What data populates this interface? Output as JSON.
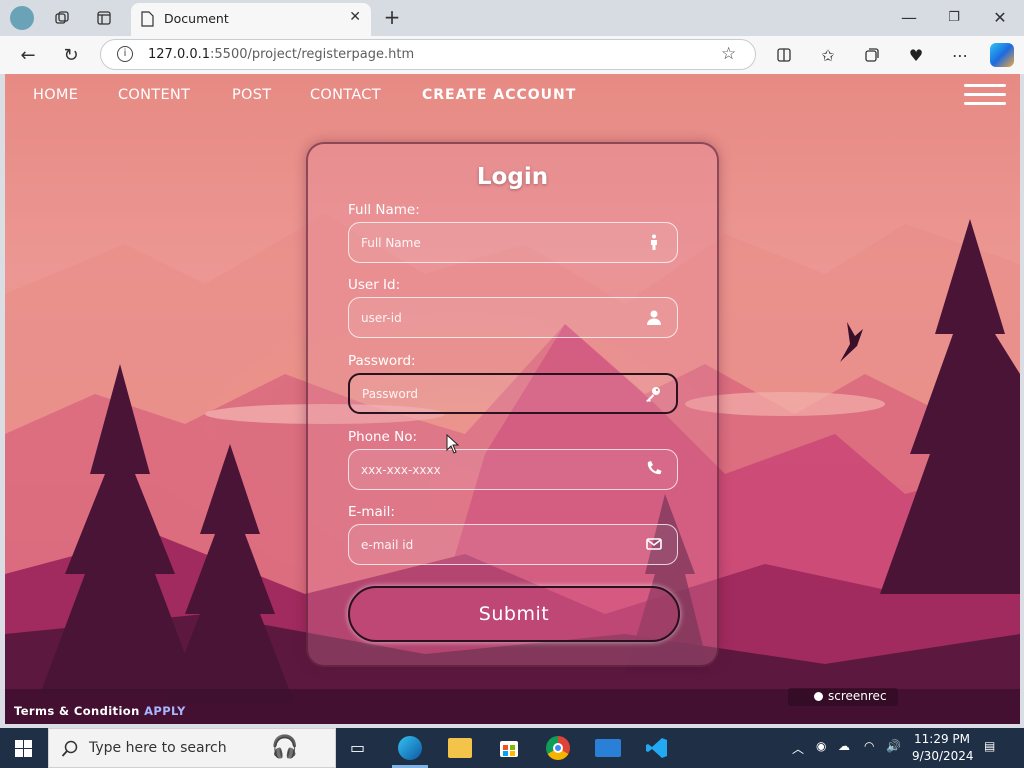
{
  "browser": {
    "tab_title": "Document",
    "url_host": "127.0.0.1",
    "url_rest": ":5500/project/registerpage.htm"
  },
  "nav": {
    "items": [
      "HOME",
      "CONTENT",
      "POST",
      "CONTACT"
    ],
    "create_account": "CREATE ACCOUNT"
  },
  "form": {
    "title": "Login",
    "fields": [
      {
        "label": "Full Name:",
        "placeholder": "Full Name",
        "icon": "person-standing-icon"
      },
      {
        "label": "User Id:",
        "placeholder": "user-id",
        "icon": "user-icon"
      },
      {
        "label": "Password:",
        "placeholder": "Password",
        "icon": "key-icon"
      },
      {
        "label": "Phone No:",
        "placeholder": "xxx-xxx-xxxx",
        "icon": "phone-icon"
      },
      {
        "label": "E-mail:",
        "placeholder": "e-mail id",
        "icon": "envelope-icon"
      }
    ],
    "submit": "Submit"
  },
  "footer": {
    "terms": "Terms & Condition",
    "apply": "APPLY",
    "recorder": "screenrec"
  },
  "taskbar": {
    "search_placeholder": "Type here to search",
    "time": "11:29 PM",
    "date": "9/30/2024"
  }
}
